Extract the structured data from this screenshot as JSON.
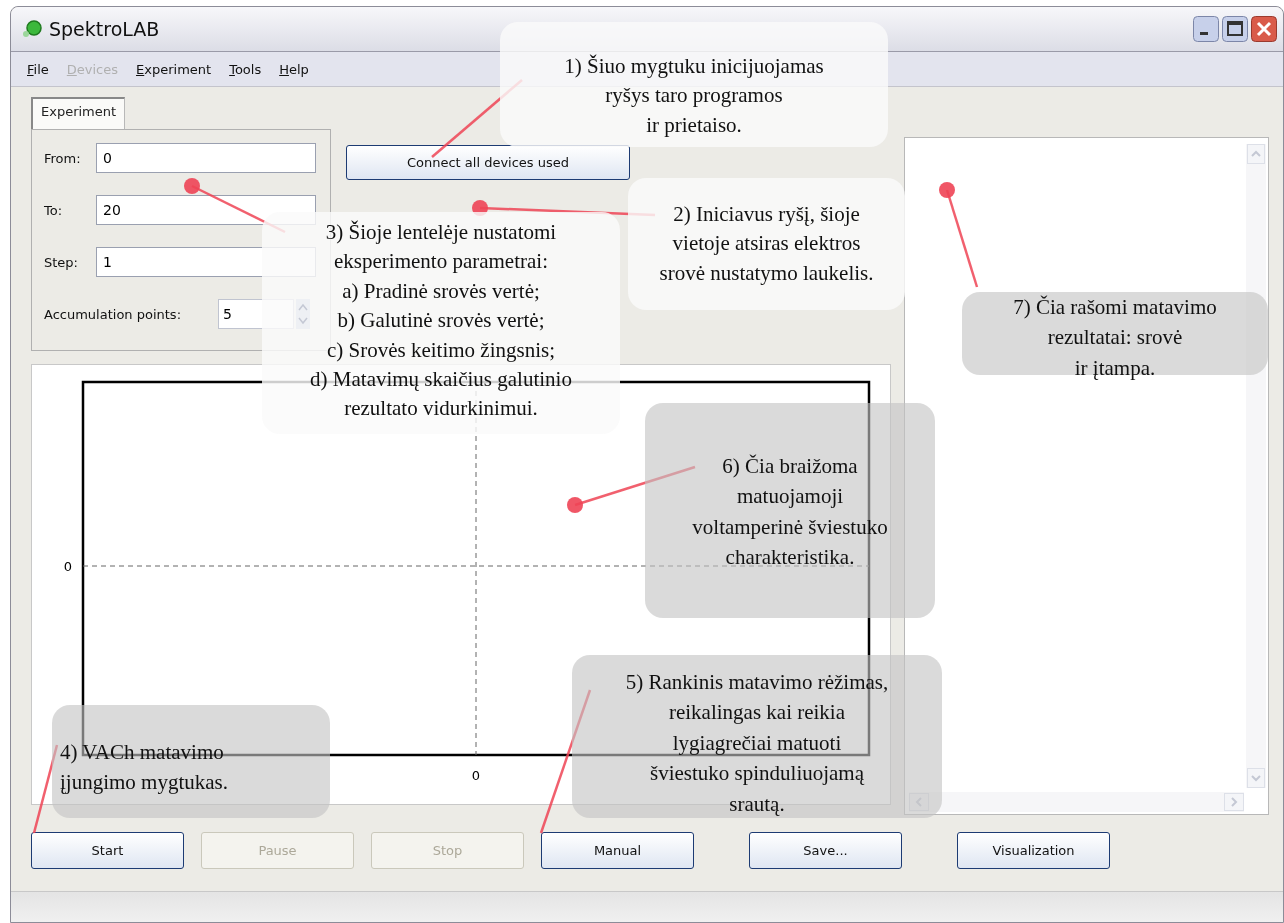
{
  "window": {
    "title": "SpektroLAB"
  },
  "menu": [
    {
      "label": "File",
      "disabled": false
    },
    {
      "label": "Devices",
      "disabled": true
    },
    {
      "label": "Experiment",
      "disabled": false
    },
    {
      "label": "Tools",
      "disabled": false
    },
    {
      "label": "Help",
      "disabled": false
    }
  ],
  "tabs": [
    {
      "label": "Experiment",
      "selected": true
    }
  ],
  "parameters": [
    {
      "label": "From:",
      "value": "0",
      "kind": "text"
    },
    {
      "label": "To:",
      "value": "20",
      "kind": "text"
    },
    {
      "label": "Step:",
      "value": "1",
      "kind": "text"
    },
    {
      "label": "Accumulation points:",
      "value": "5",
      "kind": "spinner"
    }
  ],
  "connect_button": "Connect all devices used",
  "plot": {
    "y_tick": "0",
    "x_tick": "0"
  },
  "buttons": [
    {
      "label": "Start",
      "disabled": false
    },
    {
      "label": "Pause",
      "disabled": true
    },
    {
      "label": "Stop",
      "disabled": true
    },
    {
      "label": "Manual",
      "disabled": false
    },
    {
      "label": "Save...",
      "disabled": false
    },
    {
      "label": "Visualization",
      "disabled": false
    }
  ],
  "callouts": [
    {
      "kind": "light",
      "lines": [
        "1) Šiuo mygtuku inicijuojamas",
        "ryšys taro programos",
        "ir prietaiso."
      ]
    },
    {
      "kind": "light",
      "lines": [
        "2) Iniciavus ryšį, šioje",
        "vietoje atsiras elektros",
        "srovė nustatymo laukelis."
      ]
    },
    {
      "kind": "light",
      "lines": [
        "3) Šioje lentelėje nustatomi",
        "eksperimento parametrai:",
        "a) Pradinė srovės vertė;",
        "b) Galutinė srovės vertė;",
        "c) Srovės keitimo žingsnis;",
        "d) Matavimų skaičius galutinio",
        "rezultato vidurkinimui."
      ]
    },
    {
      "kind": "dark",
      "lines": [
        "7) Čia rašomi matavimo",
        "rezultatai: srovė",
        "ir įtampa."
      ]
    },
    {
      "kind": "dark",
      "lines": [
        "6) Čia braižoma",
        "matuojamoji",
        "voltamperinė šviestuko",
        "charakteristika."
      ]
    },
    {
      "kind": "dark",
      "lines": [
        "5) Rankinis matavimo rėžimas,",
        "reikalingas kai reikia",
        "lygiagrečiai matuoti",
        "šviestuko spinduliuojamą",
        "srautą."
      ]
    },
    {
      "kind": "dark",
      "lines": [
        "4) VACh matavimo",
        "įjungimo mygtukas."
      ]
    }
  ]
}
